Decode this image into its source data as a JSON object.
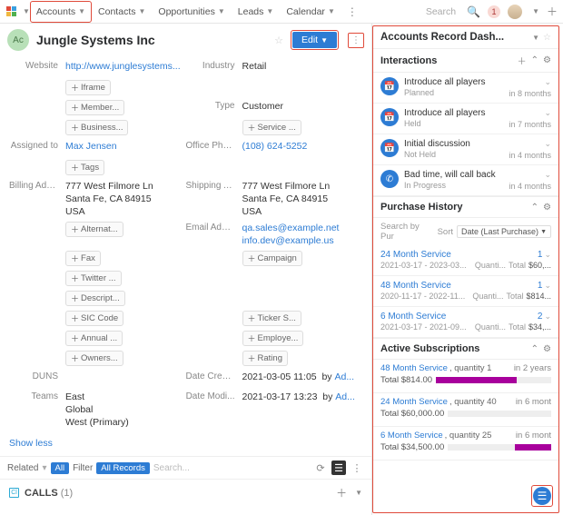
{
  "nav": {
    "tabs": [
      "Accounts",
      "Contacts",
      "Opportunities",
      "Leads",
      "Calendar"
    ],
    "active": 0,
    "search_placeholder": "Search",
    "notif_count": "1"
  },
  "record": {
    "avatar": "Ac",
    "name": "Jungle Systems Inc",
    "edit_label": "Edit"
  },
  "fields": {
    "website": {
      "label": "Website",
      "value": "http://www.junglesystems..."
    },
    "industry": {
      "label": "Industry",
      "value": "Retail"
    },
    "iframe": {
      "label": "Iframe"
    },
    "member": {
      "label": "Member..."
    },
    "type": {
      "label": "Type",
      "value": "Customer"
    },
    "business": {
      "label": "Business..."
    },
    "service": {
      "label": "Service ..."
    },
    "assigned": {
      "label": "Assigned to",
      "value": "Max Jensen"
    },
    "office_phone": {
      "label": "Office Phone",
      "value": "(108) 624-5252"
    },
    "tags": {
      "label": "Tags"
    },
    "billing": {
      "label": "Billing Add...",
      "l1": "777 West Filmore Ln",
      "l2": "Santa Fe, CA 84915",
      "l3": "USA"
    },
    "shipping": {
      "label": "Shipping A...",
      "l1": "777 West Filmore Ln",
      "l2": "Santa Fe, CA 84915",
      "l3": "USA"
    },
    "alternat": {
      "label": "Alternat..."
    },
    "email": {
      "label": "Email Addr...",
      "v1": "qa.sales@example.net",
      "v2": "info.dev@example.us"
    },
    "fax": {
      "label": "Fax"
    },
    "campaign": {
      "label": "Campaign"
    },
    "twitter": {
      "label": "Twitter ..."
    },
    "descript": {
      "label": "Descript..."
    },
    "sic": {
      "label": "SIC Code"
    },
    "ticker": {
      "label": "Ticker S..."
    },
    "annual": {
      "label": "Annual ..."
    },
    "employe": {
      "label": "Employe..."
    },
    "owners": {
      "label": "Owners..."
    },
    "rating": {
      "label": "Rating"
    },
    "duns": {
      "label": "DUNS"
    },
    "date_creat": {
      "label": "Date Creat...",
      "value": "2021-03-05 11:05",
      "by": "by",
      "user": "Ad..."
    },
    "teams": {
      "label": "Teams",
      "l1": "East",
      "l2": "Global",
      "l3": "West (Primary)"
    },
    "date_modi": {
      "label": "Date Modi...",
      "value": "2021-03-17 13:23",
      "by": "by",
      "user": "Ad..."
    }
  },
  "show_less": "Show less",
  "related": {
    "label": "Related",
    "all": "All",
    "filter": "Filter",
    "all_records": "All Records",
    "search": "Search..."
  },
  "calls": {
    "icon": "Cl",
    "title": "CALLS",
    "count": "(1)"
  },
  "dash": {
    "title": "Accounts Record Dash...",
    "interactions": {
      "title": "Interactions",
      "items": [
        {
          "name": "Introduce all players",
          "status": "Planned",
          "time": "in 8 months"
        },
        {
          "name": "Introduce all players",
          "status": "Held",
          "time": "in 7 months"
        },
        {
          "name": "Initial discussion",
          "status": "Not Held",
          "time": "in 4 months"
        },
        {
          "name": "Bad time, will call back",
          "status": "In Progress",
          "time": "in 4 months",
          "call": true
        }
      ]
    },
    "purchase": {
      "title": "Purchase History",
      "search": "Search by Pur",
      "sort_label": "Sort",
      "sort_value": "Date (Last Purchase)",
      "items": [
        {
          "product": "24 Month Service",
          "qty": "1",
          "dates": "2021-03-17 - 2023-03...",
          "quant": "Quanti...",
          "total_l": "Total",
          "total_v": "$60,..."
        },
        {
          "product": "48 Month Service",
          "qty": "1",
          "dates": "2020-11-17 - 2022-11...",
          "quant": "Quanti...",
          "total_l": "Total",
          "total_v": "$814..."
        },
        {
          "product": "6 Month Service",
          "qty": "2",
          "dates": "2021-03-17 - 2021-09...",
          "quant": "Quanti...",
          "total_l": "Total",
          "total_v": "$34,..."
        }
      ]
    },
    "subs": {
      "title": "Active Subscriptions",
      "items": [
        {
          "product": "48 Month Service",
          "qty": ", quantity 1",
          "time": "in 2 years",
          "total": "Total $814.00",
          "fill": 70,
          "right": false
        },
        {
          "product": "24 Month Service",
          "qty": ", quantity 40",
          "time": "in 6 mont",
          "total": "Total $60,000.00",
          "fill": 0,
          "right": false
        },
        {
          "product": "6 Month Service",
          "qty": ", quantity 25",
          "time": "in 6 mont",
          "total": "Total $34,500.00",
          "fill": 35,
          "right": true
        }
      ]
    }
  }
}
